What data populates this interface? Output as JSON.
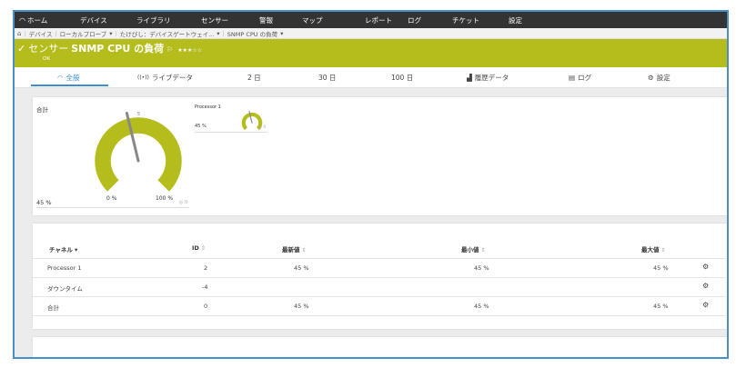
{
  "nav": {
    "home": "ホーム",
    "devices": "デバイス",
    "library": "ライブラリ",
    "sensors": "センサー",
    "alarms": "警報",
    "maps": "マップ",
    "reports": "レポート",
    "logs": "ログ",
    "tickets": "チケット",
    "setup": "設定"
  },
  "breadcrumb": [
    "デバイス",
    "ローカルプローブ",
    "たけびし：デバイスゲートウェイ...",
    "SNMP CPU の負荷"
  ],
  "sensor": {
    "prefix": "センサー",
    "name": "SNMP CPU の負荷",
    "status": "OK",
    "stars": "★★★☆☆",
    "status_color": "#b5bd1c"
  },
  "tabs": [
    "全般",
    "ライブデータ",
    "2 日",
    "30 日",
    "100 日",
    "履歴データ",
    "ログ",
    "設定"
  ],
  "gauges": {
    "total": {
      "label": "合計",
      "value": "45 %",
      "min_label": "0 %",
      "max_label": "100 %",
      "percent": 45,
      "tick": "5"
    },
    "processor1": {
      "label": "Processor 1",
      "value": "45 %",
      "percent": 45
    }
  },
  "table": {
    "headers": [
      "チャネル",
      "ID",
      "最新値",
      "最小値",
      "最大値"
    ],
    "rows": [
      {
        "channel": "Processor 1",
        "id": "2",
        "last": "45 %",
        "min": "45 %",
        "max": "45 %"
      },
      {
        "channel": "ダウンタイム",
        "id": "-4",
        "last": "",
        "min": "",
        "max": ""
      },
      {
        "channel": "合計",
        "id": "0",
        "last": "45 %",
        "min": "45 %",
        "max": "45 %"
      }
    ]
  },
  "colors": {
    "accent": "#b5bd1c",
    "nav_bg": "#333333",
    "tab_active": "#3b8fd1"
  }
}
